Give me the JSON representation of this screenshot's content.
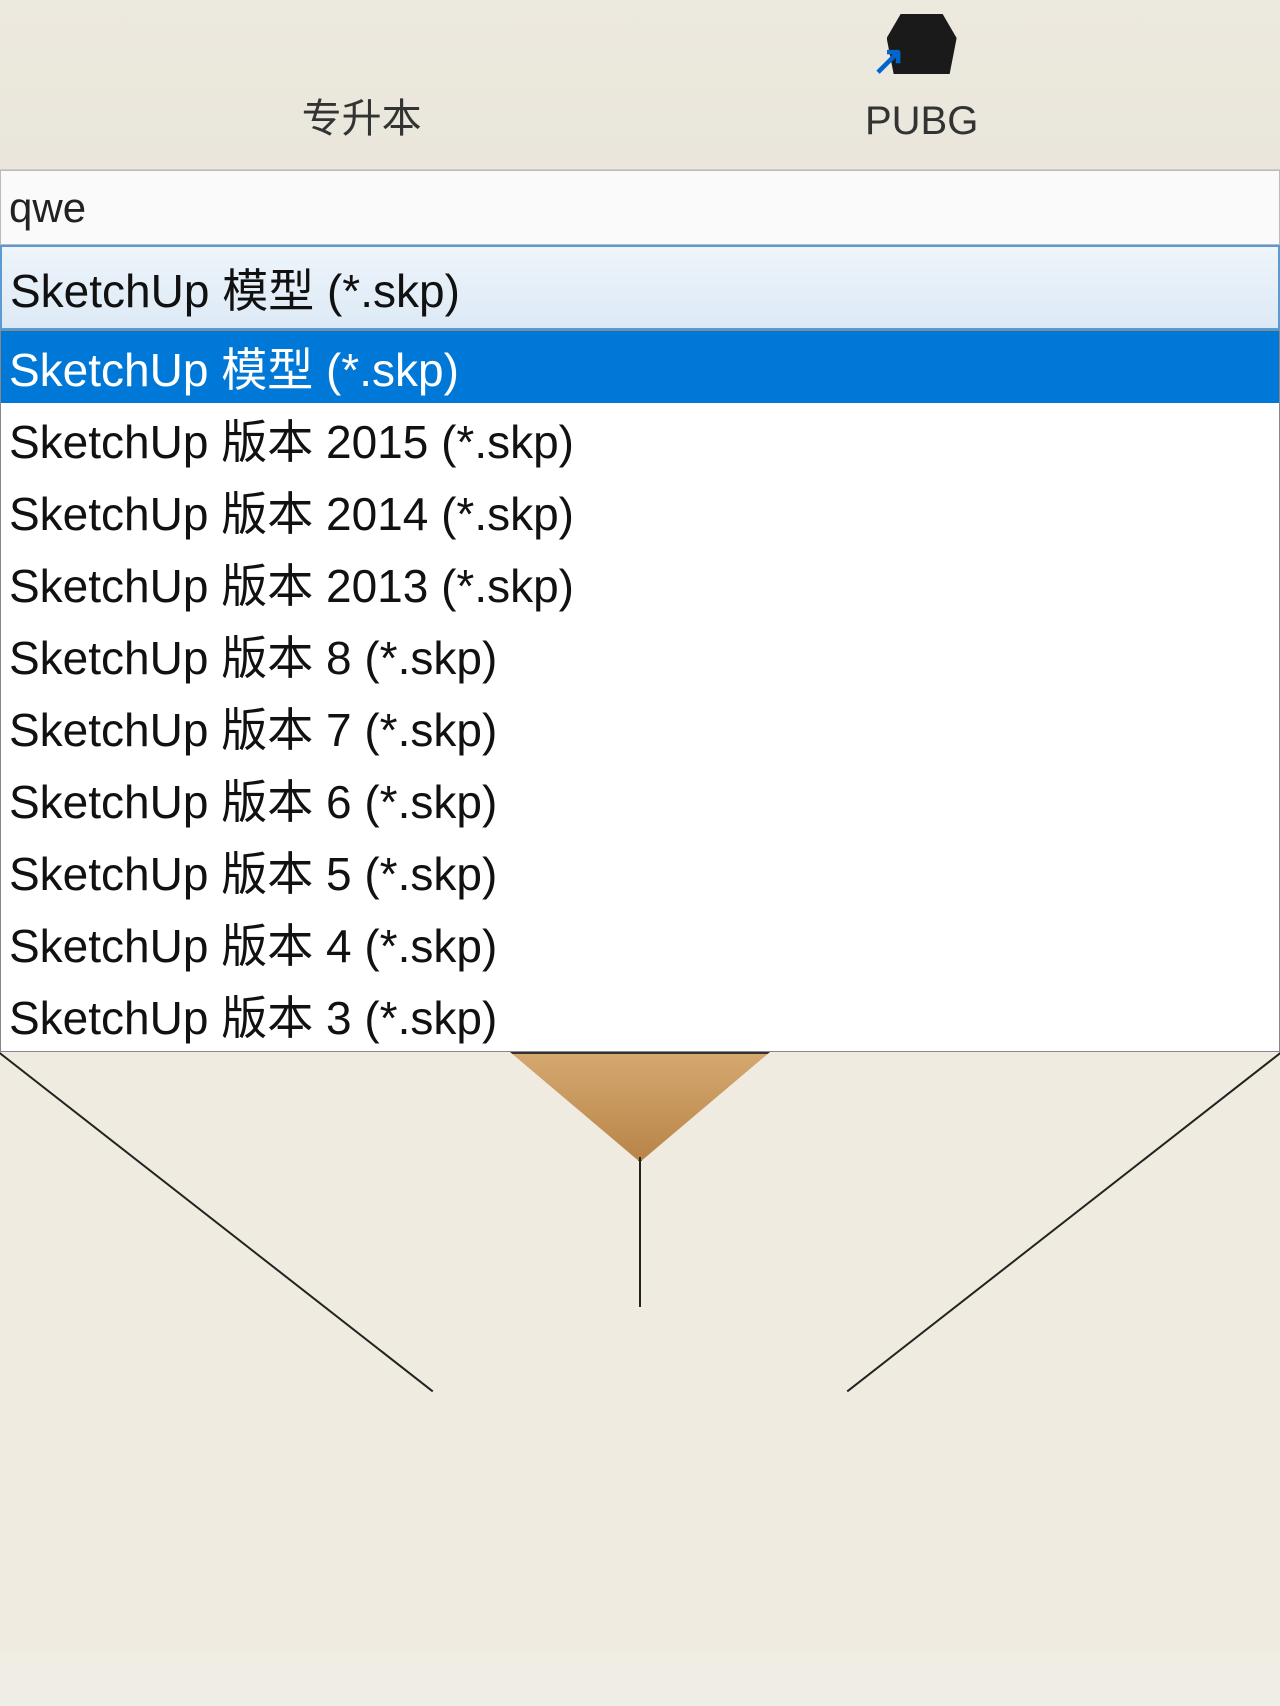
{
  "desktop": {
    "icons": [
      {
        "label": "专升本"
      },
      {
        "label": "PUBG"
      }
    ]
  },
  "dialog": {
    "filename": "qwe",
    "filetype_selected": "SketchUp 模型 (*.skp)",
    "dropdown": {
      "items": [
        {
          "label": "SketchUp 模型 (*.skp)",
          "selected": true
        },
        {
          "label": "SketchUp 版本 2015 (*.skp)",
          "selected": false
        },
        {
          "label": "SketchUp 版本 2014 (*.skp)",
          "selected": false
        },
        {
          "label": "SketchUp 版本 2013 (*.skp)",
          "selected": false
        },
        {
          "label": "SketchUp 版本 8 (*.skp)",
          "selected": false
        },
        {
          "label": "SketchUp 版本 7 (*.skp)",
          "selected": false
        },
        {
          "label": "SketchUp 版本 6 (*.skp)",
          "selected": false
        },
        {
          "label": "SketchUp 版本 5 (*.skp)",
          "selected": false
        },
        {
          "label": "SketchUp 版本 4 (*.skp)",
          "selected": false
        },
        {
          "label": "SketchUp 版本 3 (*.skp)",
          "selected": false
        }
      ]
    }
  }
}
